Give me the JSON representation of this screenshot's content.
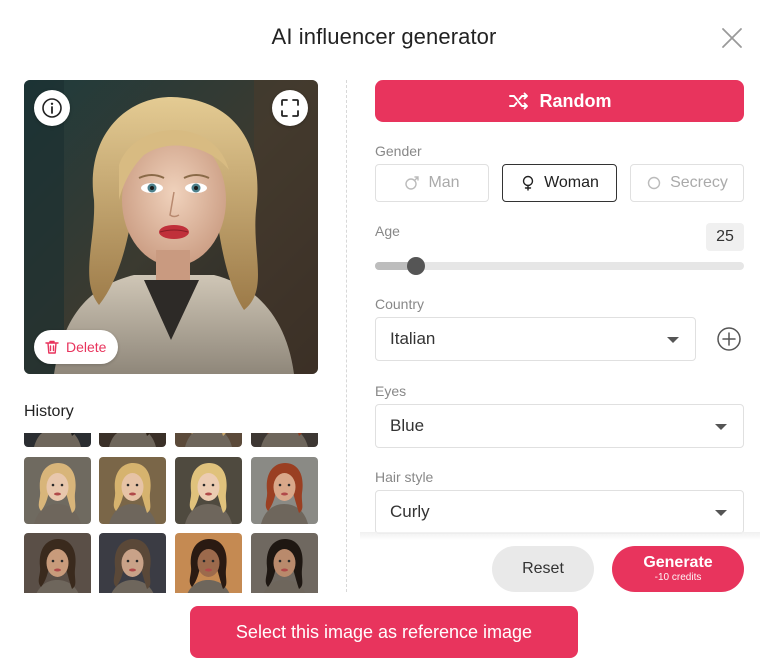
{
  "dialog": {
    "title": "AI influencer generator",
    "close_icon": "close-icon"
  },
  "preview": {
    "delete_label": "Delete",
    "info_icon": "info-icon",
    "fullscreen_icon": "fullscreen-icon"
  },
  "history": {
    "label": "History",
    "thumbnails": [
      {
        "bg": "#2a2d31",
        "skin": "#d8b59a",
        "hair": "#1e1e1e"
      },
      {
        "bg": "#3a3028",
        "skin": "#c99f83",
        "hair": "#2b2016"
      },
      {
        "bg": "#5b4a3a",
        "skin": "#e0c2a8",
        "hair": "#c9a66a"
      },
      {
        "bg": "#3d3733",
        "skin": "#d4a184",
        "hair": "#8a3a20"
      },
      {
        "bg": "#6f6a60",
        "skin": "#e8c7ad",
        "hair": "#d8b57a"
      },
      {
        "bg": "#7a6648",
        "skin": "#e6c3a6",
        "hair": "#d6b36e"
      },
      {
        "bg": "#4f4a3f",
        "skin": "#ecccb2",
        "hair": "#e0c27c"
      },
      {
        "bg": "#8a8a85",
        "skin": "#d9a88a",
        "hair": "#9a3f22"
      },
      {
        "bg": "#5a4f47",
        "skin": "#c89b7b",
        "hair": "#3a2a1d"
      },
      {
        "bg": "#3b3c44",
        "skin": "#c9a288",
        "hair": "#5a4838"
      },
      {
        "bg": "#c58a52",
        "skin": "#9c6a4c",
        "hair": "#2a1a12"
      },
      {
        "bg": "#6f6860",
        "skin": "#b98a6c",
        "hair": "#1e1712"
      }
    ]
  },
  "controls": {
    "random_label": "Random",
    "random_icon": "shuffle-icon",
    "gender": {
      "label": "Gender",
      "options": [
        {
          "label": "Man",
          "icon": "male-icon",
          "selected": false
        },
        {
          "label": "Woman",
          "icon": "female-icon",
          "selected": true
        },
        {
          "label": "Secrecy",
          "icon": "circle-icon",
          "selected": false
        }
      ]
    },
    "age": {
      "label": "Age",
      "value": "25",
      "slider_fraction": 0.11
    },
    "country": {
      "label": "Country",
      "value": "Italian",
      "add_icon": "plus-circle-icon"
    },
    "eyes": {
      "label": "Eyes",
      "value": "Blue"
    },
    "hair_style": {
      "label": "Hair style",
      "value": "Curly"
    }
  },
  "actions": {
    "reset_label": "Reset",
    "generate_label": "Generate",
    "generate_cost": "-10 credits",
    "select_reference_label": "Select this image as reference image"
  },
  "colors": {
    "accent": "#e8345d"
  }
}
